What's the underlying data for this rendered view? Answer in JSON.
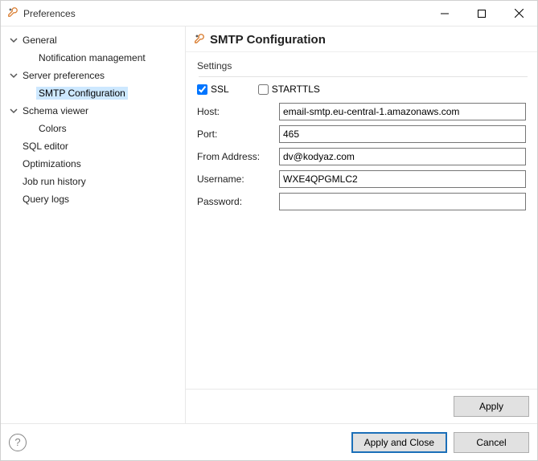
{
  "window": {
    "title": "Preferences"
  },
  "tree": {
    "items": [
      {
        "label": "General",
        "depth": 0,
        "expandable": true,
        "expanded": true,
        "selected": false
      },
      {
        "label": "Notification management",
        "depth": 1,
        "expandable": false,
        "expanded": false,
        "selected": false
      },
      {
        "label": "Server preferences",
        "depth": 0,
        "expandable": true,
        "expanded": true,
        "selected": false
      },
      {
        "label": "SMTP Configuration",
        "depth": 1,
        "expandable": false,
        "expanded": false,
        "selected": true
      },
      {
        "label": "Schema viewer",
        "depth": 0,
        "expandable": true,
        "expanded": true,
        "selected": false
      },
      {
        "label": "Colors",
        "depth": 1,
        "expandable": false,
        "expanded": false,
        "selected": false
      },
      {
        "label": "SQL editor",
        "depth": 0,
        "expandable": false,
        "expanded": false,
        "selected": false
      },
      {
        "label": "Optimizations",
        "depth": 0,
        "expandable": false,
        "expanded": false,
        "selected": false
      },
      {
        "label": "Job run history",
        "depth": 0,
        "expandable": false,
        "expanded": false,
        "selected": false
      },
      {
        "label": "Query logs",
        "depth": 0,
        "expandable": false,
        "expanded": false,
        "selected": false
      }
    ]
  },
  "page": {
    "title": "SMTP Configuration",
    "fieldset_label": "Settings",
    "ssl_label": "SSL",
    "ssl_checked": true,
    "starttls_label": "STARTTLS",
    "starttls_checked": false,
    "host_label": "Host:",
    "host_value": "email-smtp.eu-central-1.amazonaws.com",
    "port_label": "Port:",
    "port_value": "465",
    "from_label": "From Address:",
    "from_value": "dv@kodyaz.com",
    "username_label": "Username:",
    "username_value": "WXE4QPGMLC2",
    "password_label": "Password:",
    "password_value": ""
  },
  "buttons": {
    "apply": "Apply",
    "apply_close": "Apply and Close",
    "cancel": "Cancel"
  },
  "colors": {
    "accent": "#1b6fb8",
    "selection": "#cde8ff",
    "icon_orange": "#d97a2b",
    "icon_dark": "#555555"
  }
}
